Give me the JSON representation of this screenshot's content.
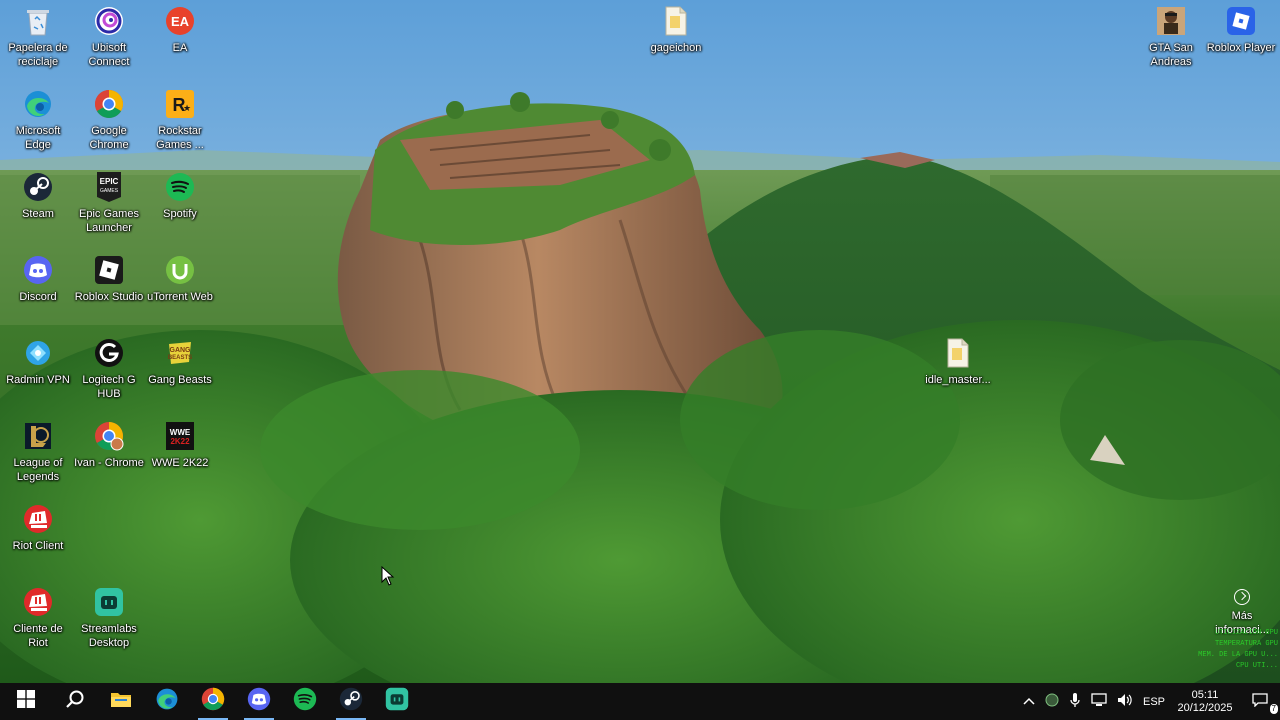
{
  "desktop": {
    "icons": [
      {
        "label": "Papelera de reciclaje",
        "icon": "recycle-bin-icon"
      },
      {
        "label": "Ubisoft Connect",
        "icon": "ubisoft-icon"
      },
      {
        "label": "EA",
        "icon": "ea-icon"
      },
      {
        "label": "Microsoft Edge",
        "icon": "edge-icon"
      },
      {
        "label": "Google Chrome",
        "icon": "chrome-icon"
      },
      {
        "label": "Rockstar Games ...",
        "icon": "rockstar-icon"
      },
      {
        "label": "Steam",
        "icon": "steam-icon"
      },
      {
        "label": "Epic Games Launcher",
        "icon": "epic-games-icon"
      },
      {
        "label": "Spotify",
        "icon": "spotify-icon"
      },
      {
        "label": "Discord",
        "icon": "discord-icon"
      },
      {
        "label": "Roblox Studio",
        "icon": "roblox-studio-icon"
      },
      {
        "label": "uTorrent Web",
        "icon": "utorrent-icon"
      },
      {
        "label": "Radmin VPN",
        "icon": "radmin-vpn-icon"
      },
      {
        "label": "Logitech G HUB",
        "icon": "logitech-ghub-icon"
      },
      {
        "label": "Gang Beasts",
        "icon": "gang-beasts-icon"
      },
      {
        "label": "League of Legends",
        "icon": "league-of-legends-icon"
      },
      {
        "label": "Ivan - Chrome",
        "icon": "chrome-profile-icon"
      },
      {
        "label": "WWE 2K22",
        "icon": "wwe-2k22-icon"
      },
      {
        "label": "Riot Client",
        "icon": "riot-client-icon"
      },
      {
        "label": "Cliente de Riot",
        "icon": "riot-client-icon"
      },
      {
        "label": "Streamlabs Desktop",
        "icon": "streamlabs-icon"
      },
      {
        "label": "gageichon",
        "icon": "file-icon"
      },
      {
        "label": "GTA San Andreas",
        "icon": "gta-san-andreas-icon"
      },
      {
        "label": "Roblox Player",
        "icon": "roblox-player-icon"
      },
      {
        "label": "idle_master...",
        "icon": "file-icon"
      }
    ],
    "info_button_label": "Más informaci...",
    "overlay_stats": [
      "UTILIZACIÓN GPU",
      "TEMPERATURA GPU",
      "MEM. DE LA GPU U...",
      "CPU UTI..."
    ]
  },
  "taskbar": {
    "items": [
      {
        "name": "start-button",
        "icon": "windows-icon",
        "active": false
      },
      {
        "name": "search-button",
        "icon": "search-icon",
        "active": false
      },
      {
        "name": "file-explorer-button",
        "icon": "folder-icon",
        "active": false
      },
      {
        "name": "edge-taskbar-button",
        "icon": "edge-icon",
        "active": false
      },
      {
        "name": "chrome-taskbar-button",
        "icon": "chrome-icon",
        "active": true
      },
      {
        "name": "discord-taskbar-button",
        "icon": "discord-icon",
        "active": true
      },
      {
        "name": "spotify-taskbar-button",
        "icon": "spotify-icon",
        "active": false
      },
      {
        "name": "steam-taskbar-button",
        "icon": "steam-icon",
        "active": true
      },
      {
        "name": "streamlabs-taskbar-button",
        "icon": "streamlabs-icon",
        "active": false
      }
    ],
    "tray": {
      "language": "ESP",
      "time": "05:11",
      "date": "20/12/2025",
      "notification_count": "7"
    }
  },
  "colors": {
    "taskbar_bg": "#101010",
    "active_indicator": "#7ab8f5",
    "overlay_text": "#2bdc2b"
  }
}
